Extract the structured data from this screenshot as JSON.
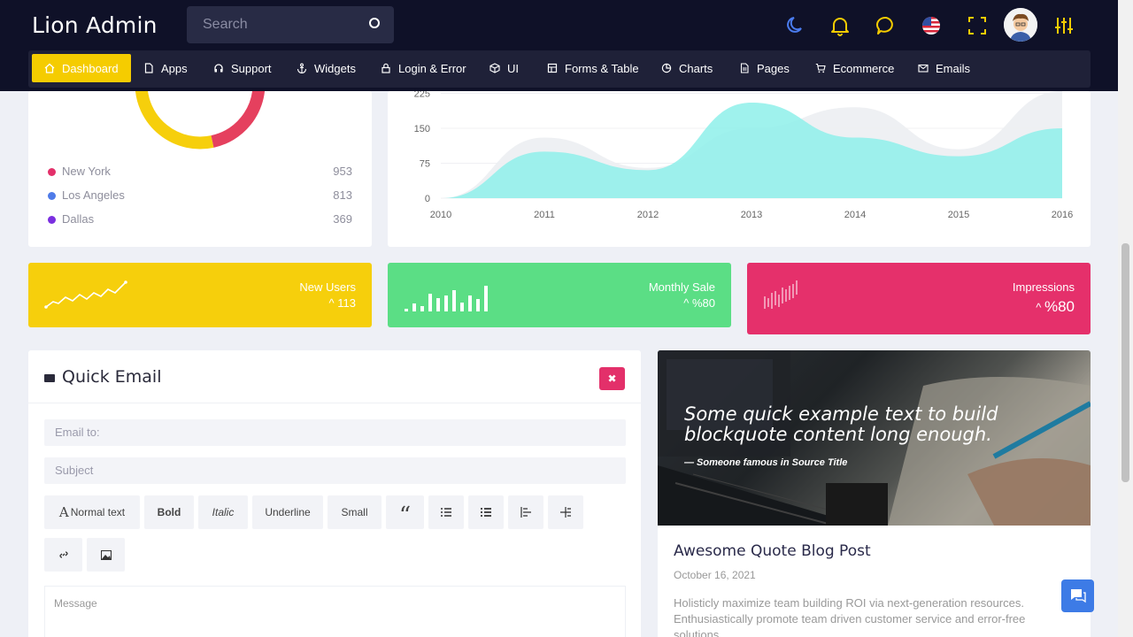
{
  "app": {
    "title": "Lion Admin"
  },
  "search": {
    "placeholder": "Search"
  },
  "header_icons": [
    "moon-icon",
    "bell-icon",
    "chat-icon",
    "us-flag-icon",
    "fullscreen-icon",
    "avatar",
    "settings-sliders-icon"
  ],
  "nav": {
    "items": [
      {
        "label": "Dashboard",
        "icon": "home-icon",
        "active": true
      },
      {
        "label": "Apps",
        "icon": "file-icon"
      },
      {
        "label": "Support",
        "icon": "headphones-icon"
      },
      {
        "label": "Widgets",
        "icon": "anchor-icon"
      },
      {
        "label": "Login & Error",
        "icon": "lock-icon"
      },
      {
        "label": "UI",
        "icon": "cube-icon"
      },
      {
        "label": "Forms & Table",
        "icon": "table-icon"
      },
      {
        "label": "Charts",
        "icon": "pie-icon"
      },
      {
        "label": "Pages",
        "icon": "page-icon"
      },
      {
        "label": "Ecommerce",
        "icon": "cart-icon"
      },
      {
        "label": "Emails",
        "icon": "mail-icon"
      }
    ]
  },
  "donut": {
    "legend": [
      {
        "label": "New York",
        "value": "953",
        "color": "#e3306a"
      },
      {
        "label": "Los Angeles",
        "value": "813",
        "color": "#4f7be8"
      },
      {
        "label": "Dallas",
        "value": "369",
        "color": "#7b2fe0"
      }
    ]
  },
  "chart_data": {
    "type": "area",
    "x": [
      2010,
      2011,
      2012,
      2013,
      2014,
      2015,
      2016
    ],
    "ylim": [
      0,
      225
    ],
    "yticks": [
      "0",
      "75",
      "150",
      "225"
    ],
    "xticks": [
      "2010",
      "2011",
      "2012",
      "2013",
      "2014",
      "2015",
      "2016"
    ],
    "series": [
      {
        "values": [
          0,
          130,
          65,
          150,
          195,
          105,
          230
        ],
        "color": "#eceef2"
      },
      {
        "values": [
          0,
          100,
          60,
          205,
          130,
          90,
          150
        ],
        "color": "#8ef0ea"
      }
    ]
  },
  "tiles": [
    {
      "title": "New Users",
      "value": "113",
      "color": "#f6cf0c"
    },
    {
      "title": "Monthly Sale",
      "value": "%80",
      "color": "#5bde85"
    },
    {
      "title": "Impressions",
      "value": "%80",
      "color": "#e5306b"
    }
  ],
  "quick_email": {
    "title": "Quick Email",
    "close": "✖",
    "email_placeholder": "Email to:",
    "subject_placeholder": "Subject",
    "toolbar": {
      "normal": "Normal text",
      "bold": "Bold",
      "italic": "Italic",
      "underline": "Underline",
      "small": "Small",
      "quote": "“"
    },
    "message_placeholder": "Message"
  },
  "blog": {
    "quote": "Some quick example text to build blockquote content long enough.",
    "source": "— Someone famous in Source Title",
    "title": "Awesome Quote Blog Post",
    "date": "October 16, 2021",
    "text": "Holisticly maximize team building ROI via next-generation resources. Enthusiastically promote team driven customer service and error-free solutions."
  }
}
